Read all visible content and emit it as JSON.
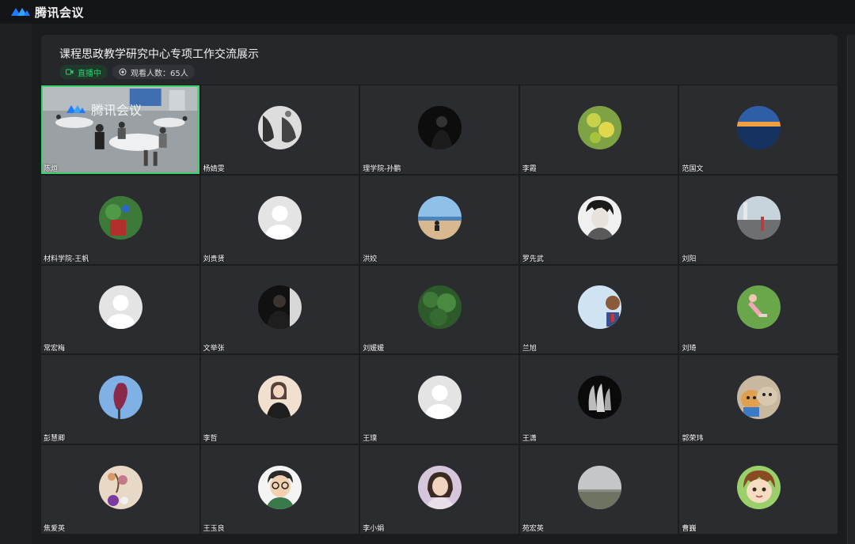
{
  "app": {
    "title": "腾讯会议"
  },
  "meeting": {
    "title": "课程思政教学研究中心专项工作交流展示",
    "live_label": "直播中",
    "viewers_label": "观看人数：65人"
  },
  "watermark": "腾讯会议",
  "colors": {
    "accent_green": "#3dd36a",
    "brand_blue": "#1e7bff"
  },
  "participants": [
    {
      "name": "陈烜"
    },
    {
      "name": "杨婧雯"
    },
    {
      "name": "理学院-孙鹏"
    },
    {
      "name": "李霞"
    },
    {
      "name": "范国文"
    },
    {
      "name": "材料学院-王帆"
    },
    {
      "name": "刘贵贤"
    },
    {
      "name": "洪姣"
    },
    {
      "name": "罗先武"
    },
    {
      "name": "刘阳"
    },
    {
      "name": "常宏梅"
    },
    {
      "name": "文举张"
    },
    {
      "name": "刘媛媛"
    },
    {
      "name": "兰旭"
    },
    {
      "name": "刘琦"
    },
    {
      "name": "彭慧卿"
    },
    {
      "name": "李哲"
    },
    {
      "name": "王璞"
    },
    {
      "name": "王潇"
    },
    {
      "name": "郭荣玮"
    },
    {
      "name": "焦爱英"
    },
    {
      "name": "王玉良"
    },
    {
      "name": "李小娟"
    },
    {
      "name": "苑宏英"
    },
    {
      "name": "曹巍"
    }
  ]
}
